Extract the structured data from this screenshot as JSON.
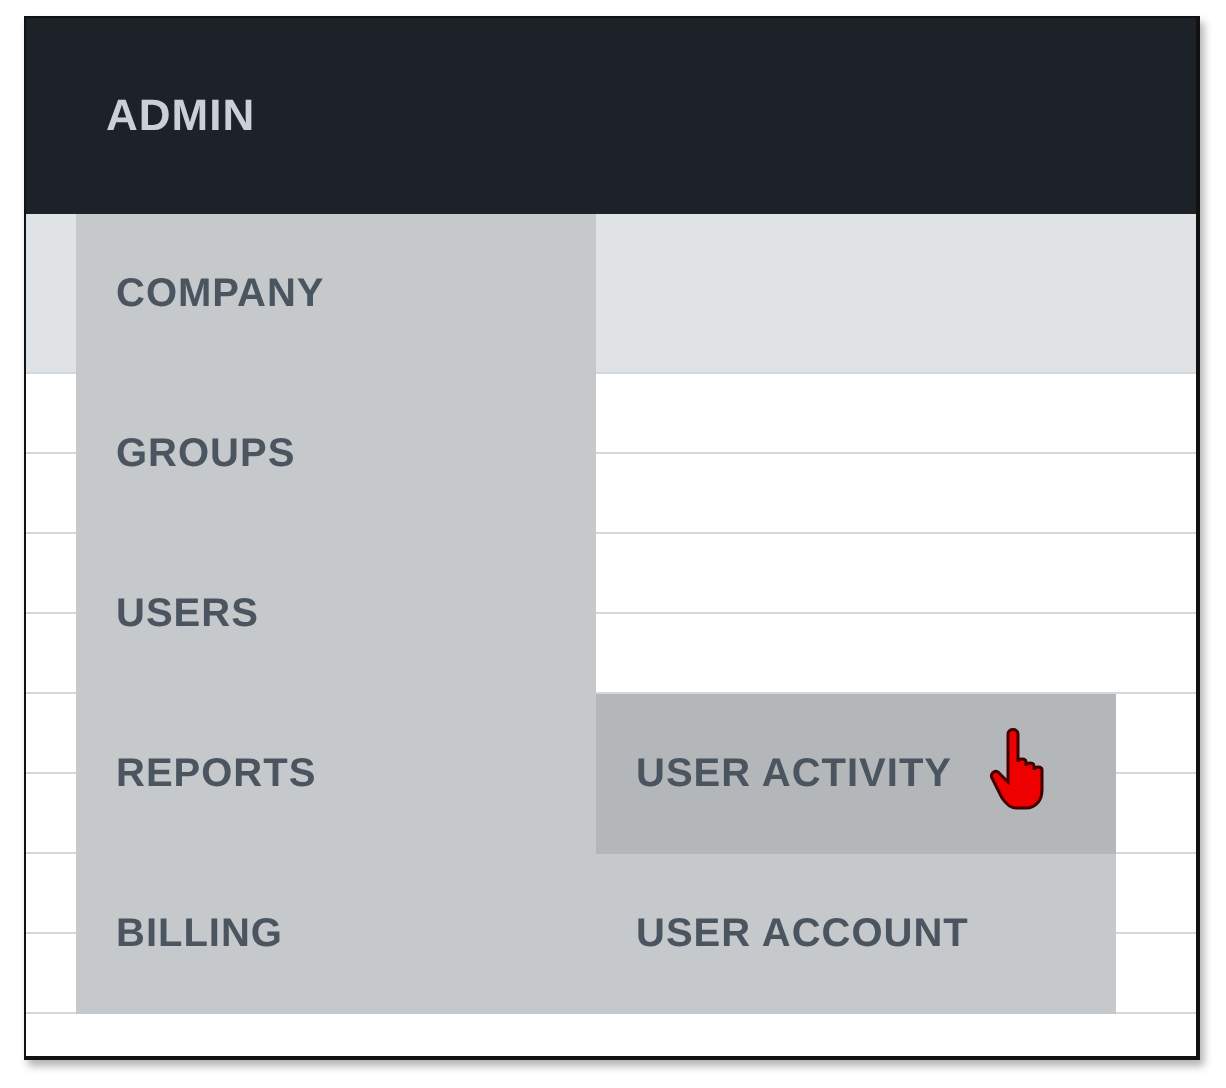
{
  "header": {
    "title": "ADMIN"
  },
  "menu": [
    {
      "label": "COMPANY"
    },
    {
      "label": "GROUPS"
    },
    {
      "label": "USERS"
    },
    {
      "label": "REPORTS",
      "submenu": [
        {
          "label": "USER ACTIVITY",
          "selected": true
        },
        {
          "label": "USER ACCOUNT",
          "selected": false
        }
      ]
    },
    {
      "label": "BILLING"
    }
  ]
}
